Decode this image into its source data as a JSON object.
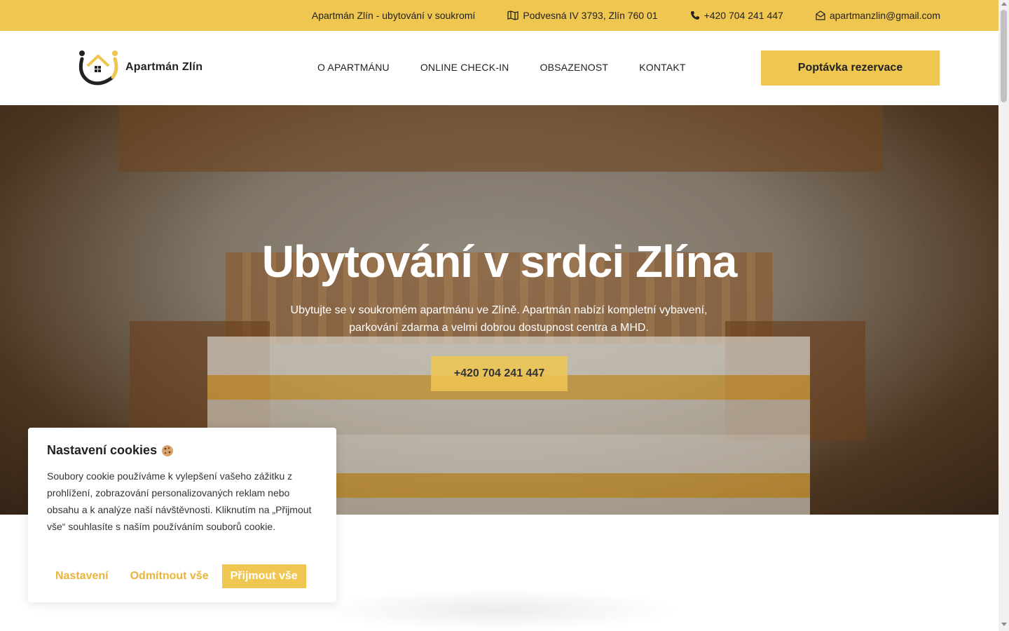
{
  "topbar": {
    "tagline": "Apartmán Zlín - ubytování v soukromí",
    "address": "Podvesná IV 3793, Zlín 760 01",
    "phone": "+420 704 241 447",
    "email": "apartmanzlin@gmail.com"
  },
  "header": {
    "logo_text": "Apartmán Zlín",
    "nav": [
      "O APARTMÁNU",
      "ONLINE CHECK-IN",
      "OBSAZENOST",
      "KONTAKT"
    ],
    "cta": "Poptávka rezervace"
  },
  "hero": {
    "title": "Ubytování v srdci Zlína",
    "text": "Ubytujte se v soukromém apartmánu ve Zlíně. Apartmán nabízí kompletní vybavení, parkování zdarma a velmi dobrou dostupnost centra a MHD.",
    "button": "+420 704 241 447"
  },
  "cookie": {
    "title": "Nastavení cookies",
    "text": "Soubory cookie používáme k vylepšení vašeho zážitku z prohlížení, zobrazování personalizovaných reklam nebo obsahu a k analýze naší návštěvnosti. Kliknutím na „Přijmout vše“ souhlasíte s naším používáním souborů cookie.",
    "settings": "Nastavení",
    "reject": "Odmítnout vše",
    "accept": "Přijmout vše"
  },
  "colors": {
    "accent": "#efc650",
    "text": "#222222"
  }
}
